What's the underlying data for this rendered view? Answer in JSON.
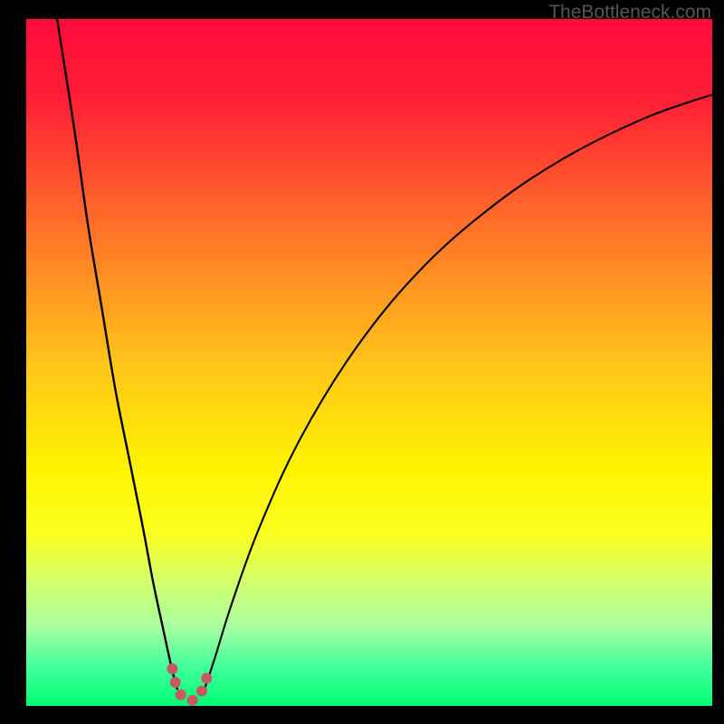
{
  "watermark": "TheBottleneck.com",
  "chart_data": {
    "type": "line",
    "title": "",
    "xlabel": "",
    "ylabel": "",
    "xlim": [
      0,
      100
    ],
    "ylim": [
      0,
      100
    ],
    "gradient_stops": [
      {
        "offset": 0.0,
        "color": "#ff0b3b"
      },
      {
        "offset": 0.12,
        "color": "#ff1f36"
      },
      {
        "offset": 0.3,
        "color": "#ff6f28"
      },
      {
        "offset": 0.5,
        "color": "#ffc319"
      },
      {
        "offset": 0.66,
        "color": "#fff500"
      },
      {
        "offset": 0.75,
        "color": "#f9ff1f"
      },
      {
        "offset": 0.82,
        "color": "#d2ff6d"
      },
      {
        "offset": 0.885,
        "color": "#a8ffa1"
      },
      {
        "offset": 0.94,
        "color": "#47ff9d"
      },
      {
        "offset": 1.0,
        "color": "#00ff73"
      }
    ],
    "left_curve": {
      "description": "steep descending curve bending slightly right",
      "points": [
        {
          "x": 4.5,
          "y": 100
        },
        {
          "x": 7.0,
          "y": 84
        },
        {
          "x": 9.0,
          "y": 70
        },
        {
          "x": 11.0,
          "y": 58
        },
        {
          "x": 13.0,
          "y": 46
        },
        {
          "x": 15.0,
          "y": 36
        },
        {
          "x": 17.0,
          "y": 26
        },
        {
          "x": 18.5,
          "y": 18
        },
        {
          "x": 20.0,
          "y": 11
        },
        {
          "x": 21.2,
          "y": 5.5
        },
        {
          "x": 22.0,
          "y": 2.5
        }
      ]
    },
    "right_curve": {
      "description": "sweeping ascending curve with decreasing slope",
      "points": [
        {
          "x": 26.0,
          "y": 2.5
        },
        {
          "x": 27.5,
          "y": 7
        },
        {
          "x": 30.0,
          "y": 15
        },
        {
          "x": 34.0,
          "y": 26
        },
        {
          "x": 40.0,
          "y": 39
        },
        {
          "x": 48.0,
          "y": 52
        },
        {
          "x": 57.0,
          "y": 63
        },
        {
          "x": 67.0,
          "y": 72
        },
        {
          "x": 78.0,
          "y": 79.5
        },
        {
          "x": 90.0,
          "y": 85.5
        },
        {
          "x": 100.0,
          "y": 89
        }
      ]
    },
    "dotted_segment": {
      "description": "short pink U at trough",
      "color": "#c65965",
      "points": [
        {
          "x": 21.3,
          "y": 5.4
        },
        {
          "x": 21.8,
          "y": 3.2
        },
        {
          "x": 22.4,
          "y": 1.8
        },
        {
          "x": 23.2,
          "y": 1.0
        },
        {
          "x": 24.0,
          "y": 0.8
        },
        {
          "x": 24.8,
          "y": 1.1
        },
        {
          "x": 25.5,
          "y": 2.0
        },
        {
          "x": 26.1,
          "y": 3.4
        },
        {
          "x": 26.6,
          "y": 5.2
        }
      ]
    }
  }
}
